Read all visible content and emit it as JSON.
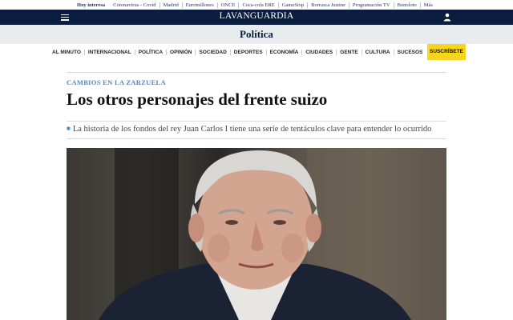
{
  "topbar": {
    "hot_label": "Hoy interesa",
    "items": [
      "Coronavirus - Covid",
      "Madrid",
      "Euromillones",
      "ONCE",
      "Coca-cola ERE",
      "GameStop",
      "Borrasca Justine",
      "Programación TV",
      "Bonoloto",
      "Más"
    ]
  },
  "header": {
    "logo_text": "LAVANGUARDIA",
    "menu_icon": "hamburger-menu-icon",
    "user_icon": "user-icon",
    "bg_color": "#0b1e40"
  },
  "section": {
    "title": "Política"
  },
  "nav": {
    "items": [
      "AL MINUTO",
      "INTERNACIONAL",
      "POLÍTICA",
      "OPINIÓN",
      "SOCIEDAD",
      "DEPORTES",
      "ECONOMÍA",
      "CIUDADES",
      "GENTE",
      "CULTURA",
      "SUCESOS"
    ],
    "subscribe_label": "SUSCRÍBETE",
    "subscribe_color": "#f7d51e"
  },
  "article": {
    "kicker": "CAMBIOS EN LA ZARZUELA",
    "headline": "Los otros personajes del frente suizo",
    "subheadline": "La historia de los fondos del rey Juan Carlos I tiene una serie de tentáculos clave para entender lo ocurrido",
    "kicker_color": "#4a88c7"
  }
}
